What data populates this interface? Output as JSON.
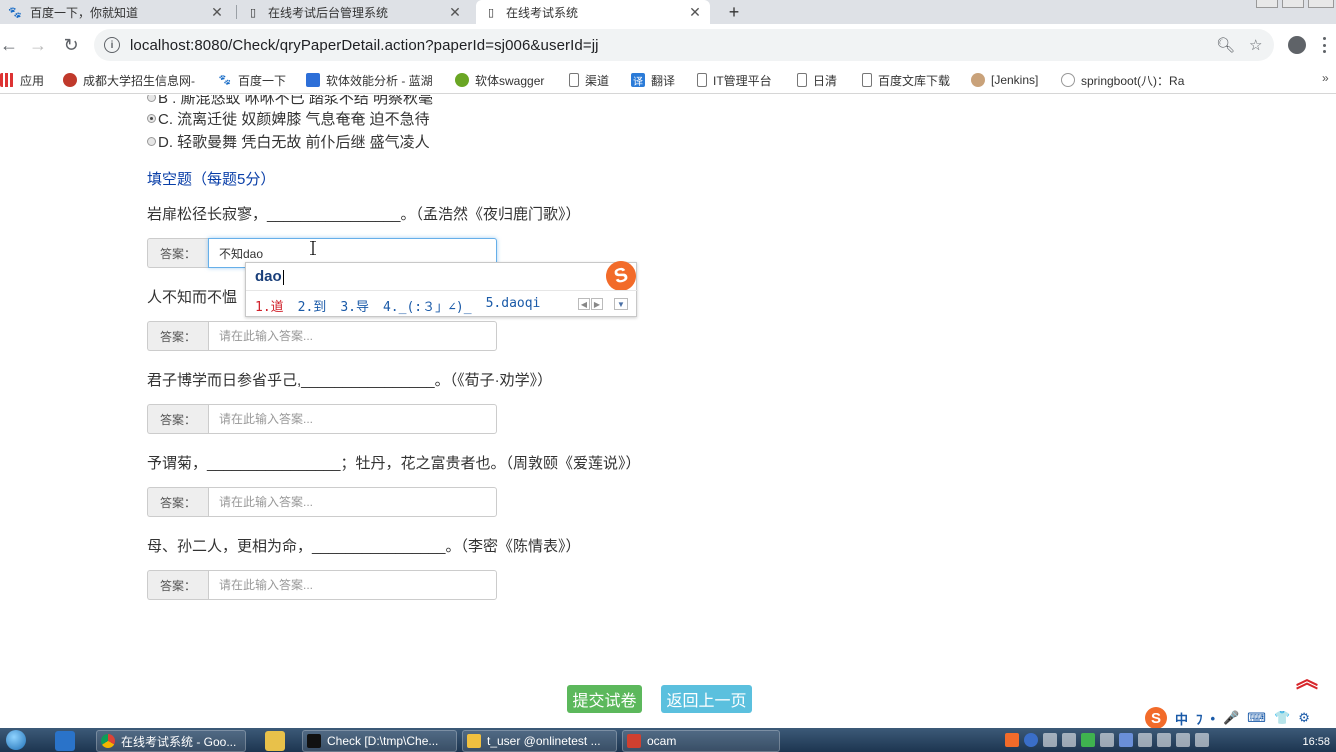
{
  "browser": {
    "tabs": [
      {
        "title": "百度一下，你就知道",
        "active": false,
        "icon": "paw-icon"
      },
      {
        "title": "在线考试后台管理系统",
        "active": false,
        "icon": "page-icon"
      },
      {
        "title": "在线考试系统",
        "active": true,
        "icon": "page-icon"
      }
    ],
    "new_tab": "+",
    "url": "localhost:8080/Check/qryPaperDetail.action?paperId=sj006&userId=jj",
    "bookmarks": [
      {
        "label": "应用",
        "icon": "apps-grid-icon"
      },
      {
        "label": "成都大学招生信息网-",
        "icon": "university-icon"
      },
      {
        "label": "百度一下",
        "icon": "paw-icon"
      },
      {
        "label": "软体效能分析 - 蓝湖",
        "icon": "bird-icon"
      },
      {
        "label": "软体swagger",
        "icon": "swagger-icon"
      },
      {
        "label": "渠道",
        "icon": "page-icon"
      },
      {
        "label": "翻译",
        "icon": "translate-icon"
      },
      {
        "label": "IT管理平台",
        "icon": "page-icon"
      },
      {
        "label": "日清",
        "icon": "page-icon"
      },
      {
        "label": "百度文库下载",
        "icon": "page-icon"
      },
      {
        "label": "[Jenkins]",
        "icon": "jenkins-icon"
      },
      {
        "label": "springboot(八)：Ra",
        "icon": "cloud-icon"
      }
    ],
    "bookmarks_more": "»"
  },
  "exam": {
    "options": [
      {
        "text": "B . 厮混悠蚁 咻咻不已 踏浆不结 明察秋毫",
        "checked": false
      },
      {
        "text": "C. 流离迁徙 奴颜婢膝 气息奄奄 迫不急待",
        "checked": true
      },
      {
        "text": "D. 轻歌曼舞 凭白无故 前仆后继 盛气凌人",
        "checked": false
      }
    ],
    "section_title": "填空题（每题5分）",
    "answer_label": "答案：",
    "placeholder": "请在此输入答案...",
    "questions": [
      {
        "text": "岩扉松径长寂寥，________________。（孟浩然《夜归鹿门歌》）",
        "value": "不知dao"
      },
      {
        "text": "人不知而不愠",
        "value": ""
      },
      {
        "text": "君子博学而日参省乎己,________________。（《荀子·劝学》）",
        "value": ""
      },
      {
        "text": "予谓菊，________________；牡丹，花之富贵者也。（周敦颐《爱莲说》）",
        "value": ""
      },
      {
        "text": "母、孙二人，更相为命，________________。（李密《陈情表》）",
        "value": ""
      }
    ],
    "submit_label": "提交试卷",
    "back_label": "返回上一页"
  },
  "ime": {
    "composition": "dao",
    "candidates": [
      "1.道",
      "2.到",
      "3.导",
      "4._(:３」∠)_",
      "5.daoqi"
    ],
    "logo": "S",
    "status_items": [
      "中",
      "ﾌ",
      "•",
      "🎤",
      "⌨",
      "👕",
      "⚙"
    ]
  },
  "taskbar": {
    "windows": [
      {
        "label": "在线考试系统 - Goo...",
        "icon": "chrome-icon"
      },
      {
        "label": "Check [D:\\tmp\\Che...",
        "icon": "intellij-icon"
      },
      {
        "label": "t_user @onlinetest ...",
        "icon": "navicat-icon"
      },
      {
        "label": "ocam",
        "icon": "ocam-icon"
      }
    ],
    "clock": "16:58"
  },
  "colors": {
    "section_title": "#0a3fa8",
    "submit": "#5cb85c",
    "back": "#5bc0de",
    "ime_accent": "#f26b2a"
  }
}
